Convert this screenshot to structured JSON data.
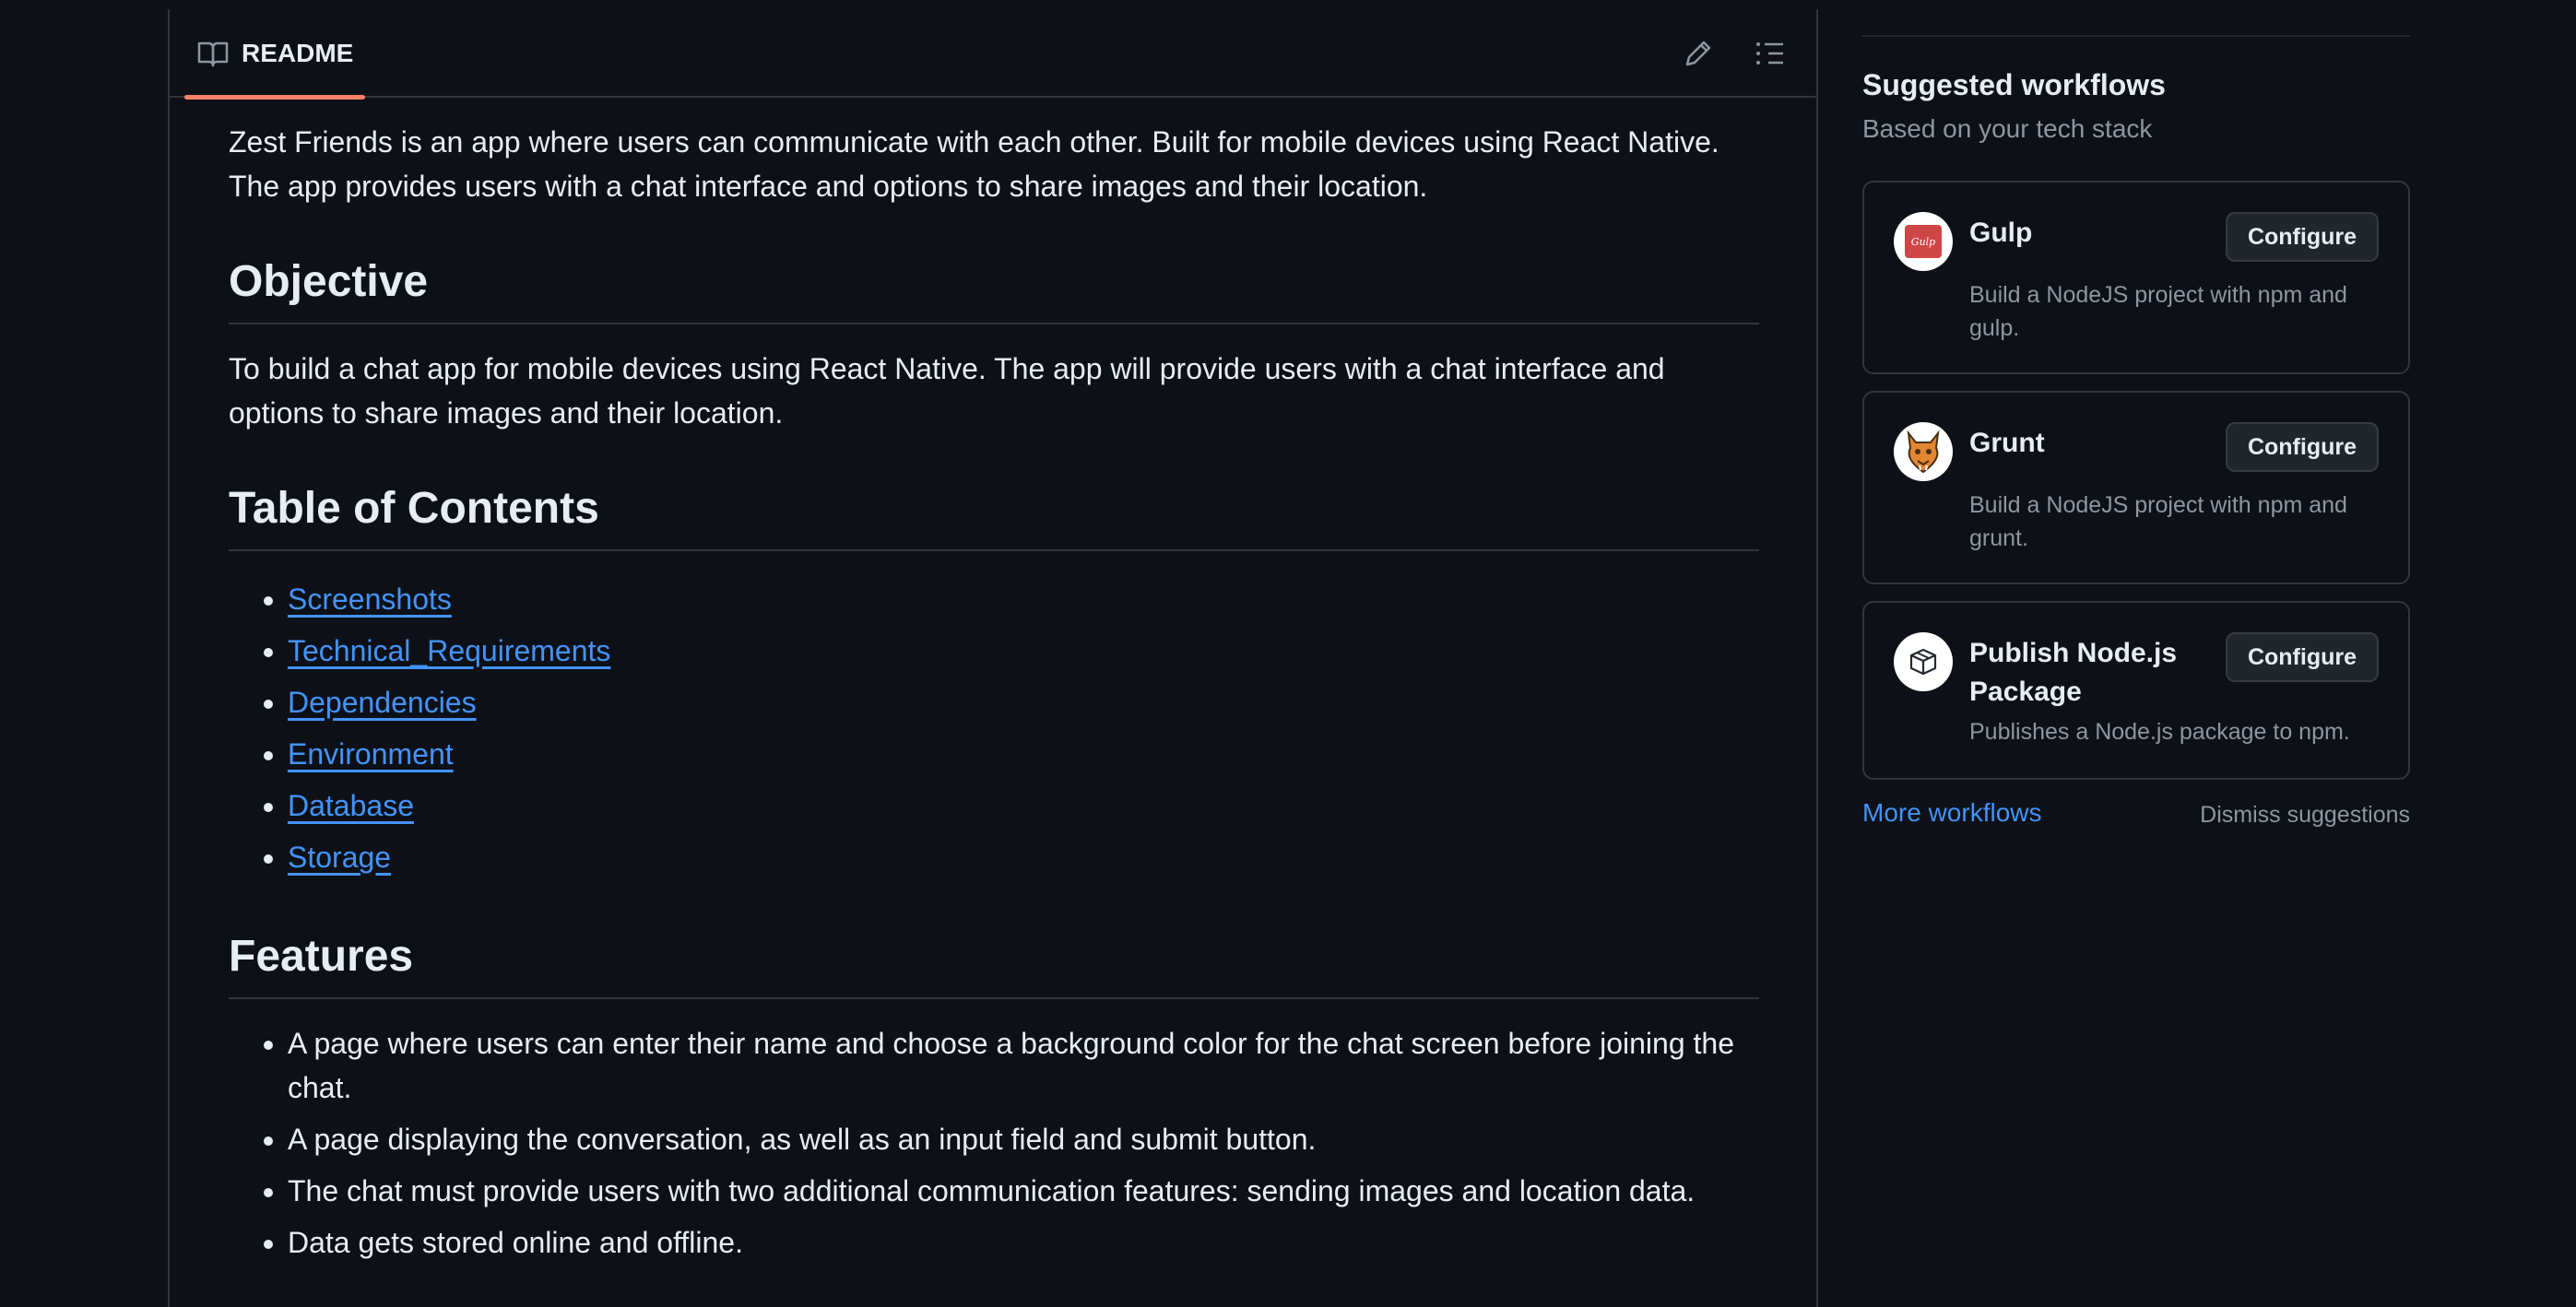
{
  "readme": {
    "tab_label": "README",
    "intro": "Zest Friends is an app where users can communicate with each other. Built for mobile devices using React Native. The app provides users with a chat interface and options to share images and their location.",
    "objective_heading": "Objective",
    "objective_text": "To build a chat app for mobile devices using React Native. The app will provide users with a chat interface and options to share images and their location.",
    "toc_heading": "Table of Contents",
    "toc": [
      "Screenshots",
      "Technical_Requirements",
      "Dependencies",
      "Environment",
      "Database",
      "Storage"
    ],
    "features_heading": "Features",
    "features": [
      "A page where users can enter their name and choose a background color for the chat screen before joining the chat.",
      "A page displaying the conversation, as well as an input field and submit button.",
      "The chat must provide users with two additional communication features: sending images and location data.",
      "Data gets stored online and offline."
    ]
  },
  "sidebar": {
    "title": "Suggested workflows",
    "subtitle": "Based on your tech stack",
    "workflows": [
      {
        "name": "Gulp",
        "description": "Build a NodeJS project with npm and gulp.",
        "button": "Configure",
        "logo_text": "Gulp"
      },
      {
        "name": "Grunt",
        "description": "Build a NodeJS project with npm and grunt.",
        "button": "Configure"
      },
      {
        "name": "Publish Node.js Package",
        "description": "Publishes a Node.js package to npm.",
        "button": "Configure"
      }
    ],
    "more_link": "More workflows",
    "dismiss": "Dismiss suggestions"
  },
  "colors": {
    "background": "#0d1117",
    "border": "#30363d",
    "link": "#4493f8",
    "tab_accent": "#f78166",
    "muted_text": "#8d96a0"
  }
}
